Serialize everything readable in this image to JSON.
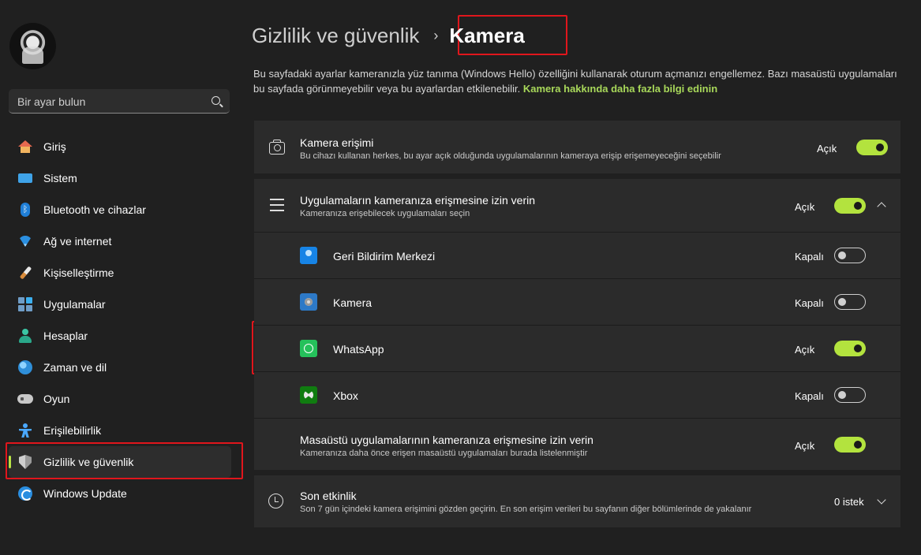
{
  "sidebar": {
    "search_placeholder": "Bir ayar bulun",
    "items": [
      {
        "label": "Giriş",
        "icon": "home-icon"
      },
      {
        "label": "Sistem",
        "icon": "system-icon"
      },
      {
        "label": "Bluetooth ve cihazlar",
        "icon": "bluetooth-icon"
      },
      {
        "label": "Ağ ve internet",
        "icon": "wifi-icon"
      },
      {
        "label": "Kişiselleştirme",
        "icon": "brush-icon"
      },
      {
        "label": "Uygulamalar",
        "icon": "apps-icon"
      },
      {
        "label": "Hesaplar",
        "icon": "account-icon"
      },
      {
        "label": "Zaman ve dil",
        "icon": "globe-clock-icon"
      },
      {
        "label": "Oyun",
        "icon": "gamepad-icon"
      },
      {
        "label": "Erişilebilirlik",
        "icon": "accessibility-icon"
      },
      {
        "label": "Gizlilik ve güvenlik",
        "icon": "shield-icon",
        "active": true
      },
      {
        "label": "Windows Update",
        "icon": "windows-update-icon"
      }
    ]
  },
  "header": {
    "parent": "Gizlilik ve güvenlik",
    "separator": "›",
    "current": "Kamera"
  },
  "description": {
    "text": "Bu sayfadaki ayarlar kameranızla yüz tanıma (Windows Hello) özelliğini kullanarak oturum açmanızı engellemez. Bazı masaüstü uygulamaları bu sayfada görünmeyebilir veya bu ayarlardan etkilenebilir.",
    "link": "Kamera hakkında daha fazla bilgi edinin"
  },
  "settings": {
    "camera_access": {
      "title": "Kamera erişimi",
      "subtitle": "Bu cihazı kullanan herkes, bu ayar açık olduğunda uygulamalarının kameraya erişip erişemeyeceğini seçebilir",
      "state": "Açık",
      "on": true
    },
    "apps_access": {
      "title": "Uygulamaların kameranıza erişmesine izin verin",
      "subtitle": "Kameranıza erişebilecek uygulamaları seçin",
      "state": "Açık",
      "on": true
    },
    "apps": [
      {
        "name": "Geri Bildirim Merkezi",
        "state": "Kapalı",
        "on": false
      },
      {
        "name": "Kamera",
        "state": "Kapalı",
        "on": false
      },
      {
        "name": "WhatsApp",
        "state": "Açık",
        "on": true
      },
      {
        "name": "Xbox",
        "state": "Kapalı",
        "on": false
      }
    ],
    "desktop_apps": {
      "title": "Masaüstü uygulamalarının kameranıza erişmesine izin verin",
      "subtitle": "Kameranıza daha önce erişen masaüstü uygulamaları burada listelenmiştir",
      "state": "Açık",
      "on": true
    },
    "recent_activity": {
      "title": "Son etkinlik",
      "subtitle": "Son 7 gün içindeki kamera erişimini gözden geçirin. En son erişim verileri bu sayfanın diğer bölümlerinde de yakalanır",
      "count": "0 istek"
    }
  },
  "colors": {
    "accent": "#b3e33e",
    "link": "#a8d85a",
    "highlight": "#e0161c"
  }
}
